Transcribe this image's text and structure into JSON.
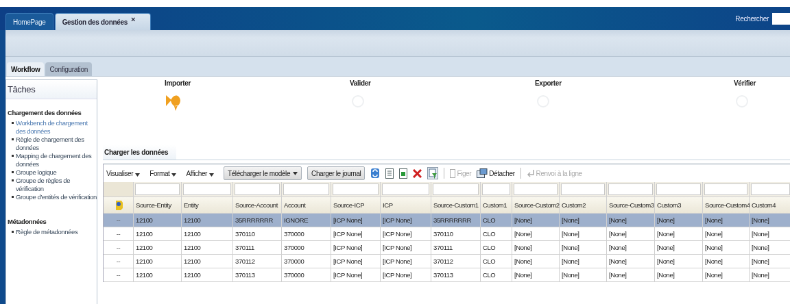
{
  "top_tabs": [
    {
      "label": "HomePage",
      "selected": false
    },
    {
      "label": "Gestion des données",
      "selected": true,
      "close": "×"
    }
  ],
  "search": {
    "label": "Rechercher"
  },
  "sub_tabs": [
    {
      "label": "Workflow",
      "selected": true
    },
    {
      "label": "Configuration",
      "selected": false
    }
  ],
  "sidebar": {
    "title": "Tâches",
    "sections": [
      {
        "heading": "Chargement des données",
        "items": [
          {
            "label": "Workbench de chargement des données",
            "selected": true
          },
          {
            "label": "Règle de chargement des données",
            "selected": false
          },
          {
            "label": "Mapping de chargement des données",
            "selected": false
          },
          {
            "label": "Groupe logique",
            "selected": false
          },
          {
            "label": "Groupe de règles de vérification",
            "selected": false
          },
          {
            "label": "Groupe d'entités de vérification",
            "selected": false
          }
        ]
      },
      {
        "heading": "Métadonnées",
        "items": [
          {
            "label": "Règle de métadonnées",
            "selected": false
          }
        ]
      }
    ]
  },
  "stages": [
    {
      "label": "Importer",
      "active": true
    },
    {
      "label": "Valider",
      "active": false
    },
    {
      "label": "Exporter",
      "active": false
    },
    {
      "label": "Vérifier",
      "active": false
    }
  ],
  "panel": {
    "title": "Charger les données",
    "toolbar": [
      {
        "kind": "menu",
        "label": "Visualiser"
      },
      {
        "kind": "menu",
        "label": "Format"
      },
      {
        "kind": "menu",
        "label": "Afficher"
      },
      {
        "kind": "dropdown",
        "label": "Télécharger le modèle"
      },
      {
        "kind": "button",
        "label": "Charger le journal"
      },
      {
        "kind": "icon"
      },
      {
        "kind": "icon"
      },
      {
        "kind": "icon"
      },
      {
        "kind": "icon"
      },
      {
        "kind": "icon"
      },
      {
        "kind": "separator"
      },
      {
        "kind": "action",
        "label": "Figer",
        "disabled": true
      },
      {
        "kind": "action",
        "label": "Détacher",
        "disabled": false
      },
      {
        "kind": "separator"
      },
      {
        "kind": "action",
        "label": "Renvoi à la ligne",
        "disabled": true
      }
    ],
    "table": {
      "columns": [
        "Source-Entity",
        "Entity",
        "Source-Account",
        "Account",
        "Source-ICP",
        "ICP",
        "Source-Custom1",
        "Custom1",
        "Source-Custom2",
        "Custom2",
        "Source-Custom3",
        "Custom3",
        "Source-Custom4",
        "Custom4"
      ],
      "rows": [
        {
          "selected": true,
          "marker": "--",
          "cells": [
            "12100",
            "12100",
            "35RRRRRRR",
            "IGNORE",
            "[ICP None]",
            "[ICP None]",
            "35RRRRRRR",
            "CLO",
            "[None]",
            "[None]",
            "[None]",
            "[None]",
            "[None]",
            "[None]"
          ]
        },
        {
          "selected": false,
          "marker": "--",
          "cells": [
            "12100",
            "12100",
            "370110",
            "370000",
            "[ICP None]",
            "[ICP None]",
            "370110",
            "CLO",
            "[None]",
            "[None]",
            "[None]",
            "[None]",
            "[None]",
            "[None]"
          ]
        },
        {
          "selected": false,
          "marker": "--",
          "cells": [
            "12100",
            "12100",
            "370111",
            "370000",
            "[ICP None]",
            "[ICP None]",
            "370111",
            "CLO",
            "[None]",
            "[None]",
            "[None]",
            "[None]",
            "[None]",
            "[None]"
          ]
        },
        {
          "selected": false,
          "marker": "--",
          "cells": [
            "12100",
            "12100",
            "370112",
            "370000",
            "[ICP None]",
            "[ICP None]",
            "370112",
            "CLO",
            "[None]",
            "[None]",
            "[None]",
            "[None]",
            "[None]",
            "[None]"
          ]
        },
        {
          "selected": false,
          "marker": "--",
          "cells": [
            "12100",
            "12100",
            "370113",
            "370000",
            "[ICP None]",
            "[ICP None]",
            "370113",
            "CLO",
            "[None]",
            "[None]",
            "[None]",
            "[None]",
            "[None]",
            "[None]"
          ]
        }
      ]
    }
  }
}
